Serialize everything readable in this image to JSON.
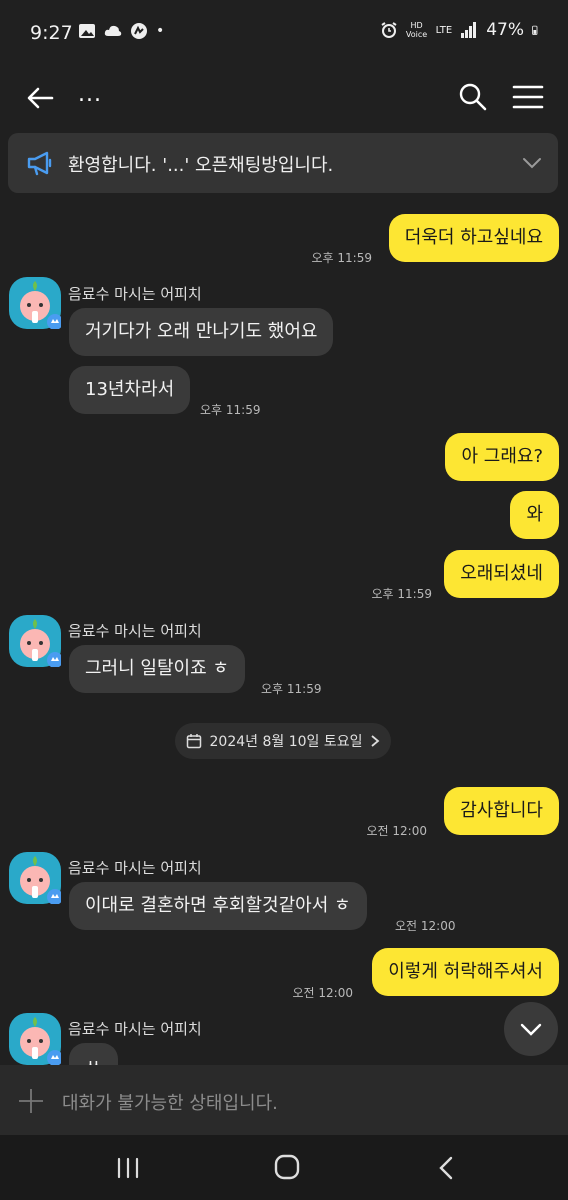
{
  "status_bar": {
    "time": "9:27",
    "battery": "47%",
    "network": "LTE",
    "voice": "HD Voice"
  },
  "header": {
    "title": "...",
    "icons": [
      "back-arrow-icon",
      "search-icon",
      "menu-icon"
    ]
  },
  "notice": {
    "text": "환영합니다. '...' 오픈채팅방입니다."
  },
  "messages": [
    {
      "from": "me",
      "text": "더욱더 하고싶네요",
      "time": "오후 11:59"
    },
    {
      "from": "other",
      "sender": "음료수 마시는 어피치",
      "text": "거기다가 오래 만나기도 했어요"
    },
    {
      "from": "other",
      "text": "13년차라서",
      "time": "오후 11:59"
    },
    {
      "from": "me",
      "text": "아 그래요?"
    },
    {
      "from": "me",
      "text": "와"
    },
    {
      "from": "me",
      "text": "오래되셨네",
      "time": "오후 11:59"
    },
    {
      "from": "other",
      "sender": "음료수 마시는 어피치",
      "text": "그러니 일탈이죠 ㅎ",
      "time": "오후 11:59"
    },
    {
      "from": "me",
      "text": "감사합니다",
      "time": "오전 12:00"
    },
    {
      "from": "other",
      "sender": "음료수 마시는 어피치",
      "text": "이대로 결혼하면 후회할것같아서 ㅎ",
      "time": "오전 12:00"
    },
    {
      "from": "me",
      "text": "이렇게 허락해주셔서",
      "time": "오전 12:00"
    },
    {
      "from": "other",
      "sender": "음료수 마시는 어피치",
      "text": "ㅆ"
    }
  ],
  "date_divider": "2024년 8월 10일 토요일",
  "input": {
    "placeholder": "대화가 불가능한 상태입니다."
  },
  "colors": {
    "background": "#202020",
    "my_bubble": "#fde633",
    "other_bubble": "#3a3a3a",
    "avatar": "#2aa9c9",
    "accent_icon": "#4a9cf0"
  }
}
